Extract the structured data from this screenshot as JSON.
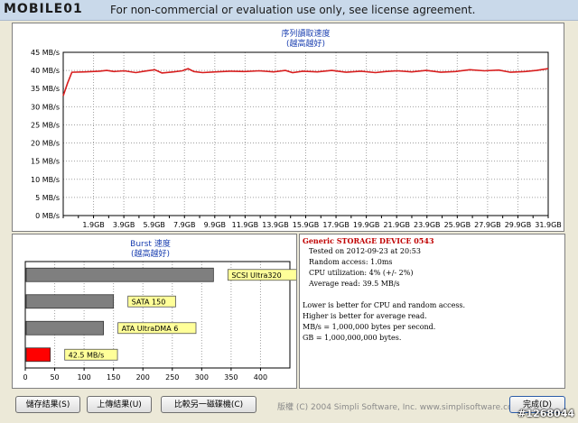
{
  "window": {
    "logo_text": "MOBILE01",
    "title": "For non-commercial or evaluation use only, see license agreement."
  },
  "colors": {
    "series": "#d81e1e",
    "chart_title": "#1a3fb0",
    "label_bg": "#ffff99",
    "device_name": "#c00000"
  },
  "chart_data": [
    {
      "type": "line",
      "title": "序列讀取速度",
      "subtitle": "(越高越好)",
      "yunit": "MB/s",
      "ylim": [
        0,
        45
      ],
      "yticks": [
        "0 MB/s",
        "5 MB/s",
        "10 MB/s",
        "15 MB/s",
        "20 MB/s",
        "25 MB/s",
        "30 MB/s",
        "35 MB/s",
        "40 MB/s",
        "45 MB/s"
      ],
      "xticks": [
        "1.9GB",
        "3.9GB",
        "5.9GB",
        "7.9GB",
        "9.9GB",
        "11.9GB",
        "13.9GB",
        "15.9GB",
        "17.9GB",
        "19.9GB",
        "21.9GB",
        "23.9GB",
        "25.9GB",
        "27.9GB",
        "29.9GB",
        "31.9GB"
      ],
      "xlim": [
        0,
        33.4
      ],
      "grid": true,
      "series": [
        {
          "values": [
            [
              0,
              33.0
            ],
            [
              0.3,
              36.5
            ],
            [
              0.6,
              39.5
            ],
            [
              1.5,
              39.6
            ],
            [
              2.5,
              39.8
            ],
            [
              3.0,
              40.0
            ],
            [
              3.5,
              39.7
            ],
            [
              4.2,
              39.9
            ],
            [
              5.0,
              39.4
            ],
            [
              5.6,
              39.8
            ],
            [
              6.3,
              40.2
            ],
            [
              6.8,
              39.3
            ],
            [
              7.6,
              39.6
            ],
            [
              8.2,
              39.9
            ],
            [
              8.6,
              40.5
            ],
            [
              9.0,
              39.7
            ],
            [
              9.6,
              39.4
            ],
            [
              10.5,
              39.6
            ],
            [
              11.5,
              39.8
            ],
            [
              12.5,
              39.7
            ],
            [
              13.5,
              39.9
            ],
            [
              14.5,
              39.6
            ],
            [
              15.3,
              40.0
            ],
            [
              15.8,
              39.4
            ],
            [
              16.5,
              39.8
            ],
            [
              17.5,
              39.6
            ],
            [
              18.5,
              40.0
            ],
            [
              19.5,
              39.5
            ],
            [
              20.5,
              39.8
            ],
            [
              21.5,
              39.4
            ],
            [
              22.2,
              39.7
            ],
            [
              23.0,
              39.9
            ],
            [
              24.0,
              39.6
            ],
            [
              25.0,
              40.0
            ],
            [
              26.0,
              39.5
            ],
            [
              27.0,
              39.7
            ],
            [
              28.0,
              40.2
            ],
            [
              29.0,
              39.9
            ],
            [
              30.0,
              40.1
            ],
            [
              30.8,
              39.5
            ],
            [
              31.8,
              39.7
            ],
            [
              32.6,
              40.0
            ],
            [
              33.4,
              40.5
            ]
          ]
        }
      ]
    },
    {
      "type": "bar",
      "orientation": "horizontal",
      "title": "Burst 速度",
      "subtitle": "(越高越好)",
      "xlim": [
        0,
        450
      ],
      "xticks": [
        "0",
        "50",
        "100",
        "150",
        "200",
        "250",
        "300",
        "350",
        "400"
      ],
      "categories": [
        "SCSI Ultra320",
        "SATA 150",
        "ATA UltraDMA 6",
        "42.5 MB/s"
      ],
      "values": [
        320,
        150,
        133,
        42.5
      ],
      "bar_colors": [
        "#7f7f7f",
        "#7f7f7f",
        "#7f7f7f",
        "#ff0000"
      ]
    }
  ],
  "info": {
    "device": "Generic STORAGE DEVICE 0543",
    "lines": [
      "Tested on 2012-09-23 at 20:53",
      "Random access: 1.0ms",
      "CPU utilization: 4% (+/- 2%)",
      "Average read: 39.5 MB/s"
    ],
    "notes": [
      "Lower is better for CPU and random access.",
      "Higher is better for average read.",
      "MB/s = 1,000,000 bytes per second.",
      "GB = 1,000,000,000 bytes."
    ]
  },
  "buttons": {
    "save": "儲存結果(S)",
    "upload": "上傳結果(U)",
    "compare": "比較另一磁碟機(C)",
    "done": "完成(D)"
  },
  "copyright": "版權 (C) 2004 Simpli Software, Inc. www.simplisoftware.com",
  "watermark": "#1268044"
}
